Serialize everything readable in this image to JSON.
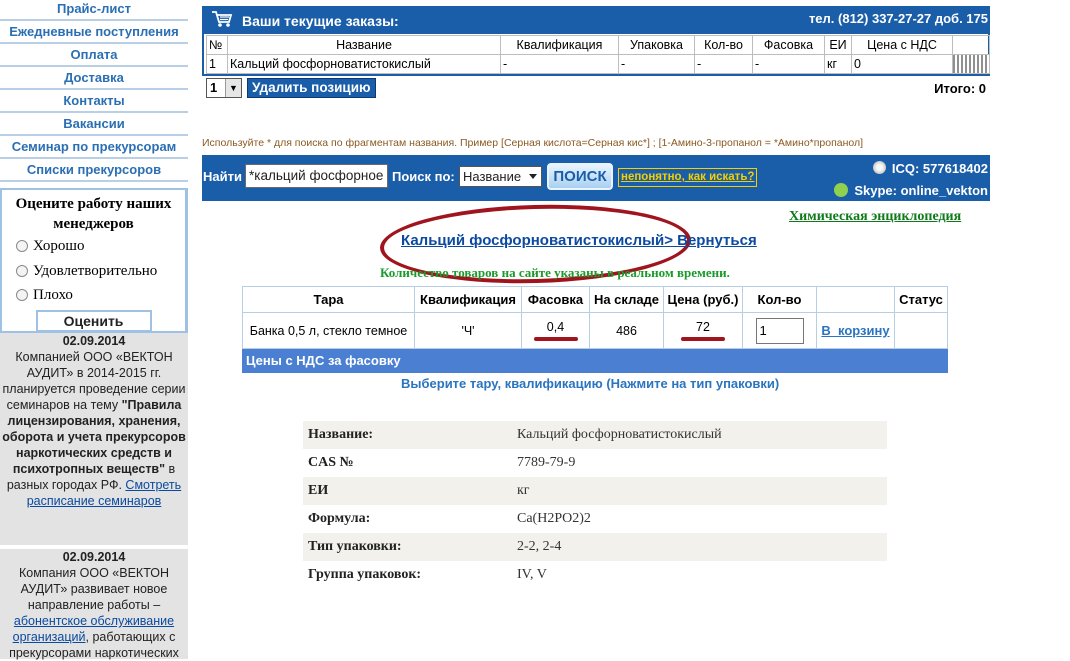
{
  "sidebar": {
    "nav_items": [
      "Прайс-лист",
      "Ежедневные поступления",
      "Оплата",
      "Доставка",
      "Контакты",
      "Вакансии",
      "Семинар по прекурсорам",
      "Списки прекурсоров"
    ],
    "rating": {
      "title": "Оцените работу наших менеджеров",
      "options": [
        "Хорошо",
        "Удовлетворительно",
        "Плохо"
      ],
      "button": "Оценить"
    },
    "news": [
      {
        "date": "02.09.2014",
        "text_plain": "Компанией ООО «ВЕКТОН АУДИТ» в 2014-2015 гг. планируется проведение серии семинаров на тему",
        "text_bold": "\"Правила лицензирования, хранения, оборота и учета прекурсоров наркотических средств и психотропных веществ\"",
        "text_after": " в разных городах РФ. ",
        "link": "Смотреть расписание семинаров"
      },
      {
        "date": "02.09.2014",
        "text_plain": "Компания ООО «ВЕКТОН АУДИТ» развивает новое направление работы – ",
        "link": "абонентское обслуживание организаций",
        "text_after": ", работающих с прекурсорами наркотических"
      }
    ]
  },
  "orders": {
    "title": "Ваши текущие заказы:",
    "phone": "тел. (812) 337-27-27 доб. 175",
    "columns": [
      "№",
      "Название",
      "Квалификация",
      "Упаковка",
      "Кол-во",
      "Фасовка",
      "ЕИ",
      "Цена с НДС",
      ""
    ],
    "rows": [
      [
        "1",
        "Кальций фосфорноватистокислый",
        "-",
        "-",
        "-",
        "-",
        "кг",
        "0",
        ""
      ]
    ],
    "selected_position": "1",
    "delete_button": "Удалить позицию",
    "total_label": "Итого: 0"
  },
  "search": {
    "hint": "Используйте * для поиска по фрагментам названия. Пример [Серная кислота=Серная кис*] ; [1-Амино-3-пропанол = *Амино*пропанол]",
    "find_label": "Найти",
    "query": "*кальций фосфорное",
    "by_label": "Поиск по:",
    "by_value": "Название",
    "button": "ПОИСК",
    "help_link": "непонятно, как искать?",
    "icq": "ICQ: 577618402",
    "skype": "Skype: online_vekton"
  },
  "encyclopedia_link": "Химическая энциклопедия",
  "product": {
    "title_link": "Кальций фосфорноватистокислый",
    "back_link": "> Вернуться",
    "qty_note": "Количество товаров на сайте указаны в реальном времени.",
    "columns": [
      "Тара",
      "Квалификация",
      "Фасовка",
      "На складе",
      "Цена (руб.)",
      "Кол-во",
      "",
      "Статус"
    ],
    "row": {
      "tara": "Банка 0,5 л, стекло темное",
      "qual": "'Ч'",
      "pack": "0,4",
      "stock": "486",
      "price": "72",
      "qty": "1",
      "cart": "В_корзину",
      "status": ""
    },
    "footer_note": "Цены с НДС за фасовку",
    "choose_note": "Выберите тару, квалификацию (Нажмите на тип упаковки)"
  },
  "properties": [
    {
      "key": "Название:",
      "value": "Кальций фосфорноватистокислый"
    },
    {
      "key": "CAS №",
      "value": "7789-79-9"
    },
    {
      "key": "ЕИ",
      "value": "кг"
    },
    {
      "key": "Формула:",
      "value": "Ca(H2PO2)2"
    },
    {
      "key": "Тип упаковки:",
      "value": "2-2, 2-4"
    },
    {
      "key": "Группа упаковок:",
      "value": "IV, V"
    }
  ],
  "colors": {
    "header_blue": "#1a5eaa",
    "nav_blue": "#2a6fb3",
    "annotation_red": "#a0141e",
    "green_note": "#1a9a2a"
  }
}
